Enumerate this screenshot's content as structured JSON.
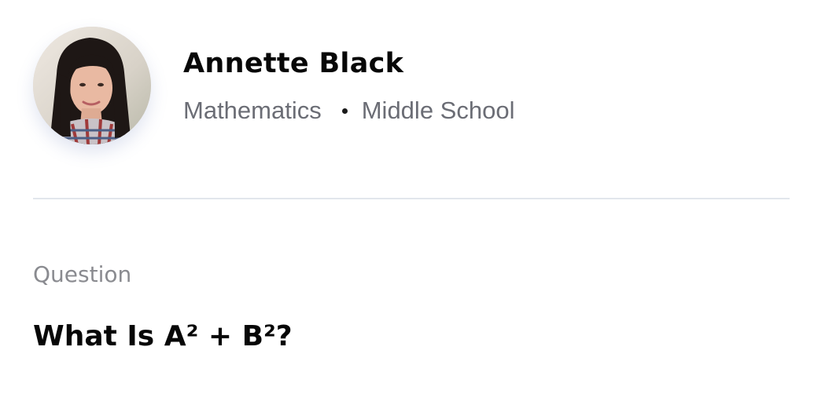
{
  "profile": {
    "name": "Annette Black",
    "subject": "Mathematics",
    "level": "Middle School",
    "avatar_icon": "user-photo"
  },
  "question": {
    "label": "Question",
    "text": "What Is A² + B²?"
  },
  "colors": {
    "name_text": "#070707",
    "meta_text": "#6b6d75",
    "label_text": "#8a8b90",
    "divider": "#e2e6ec",
    "background": "#ffffff"
  }
}
